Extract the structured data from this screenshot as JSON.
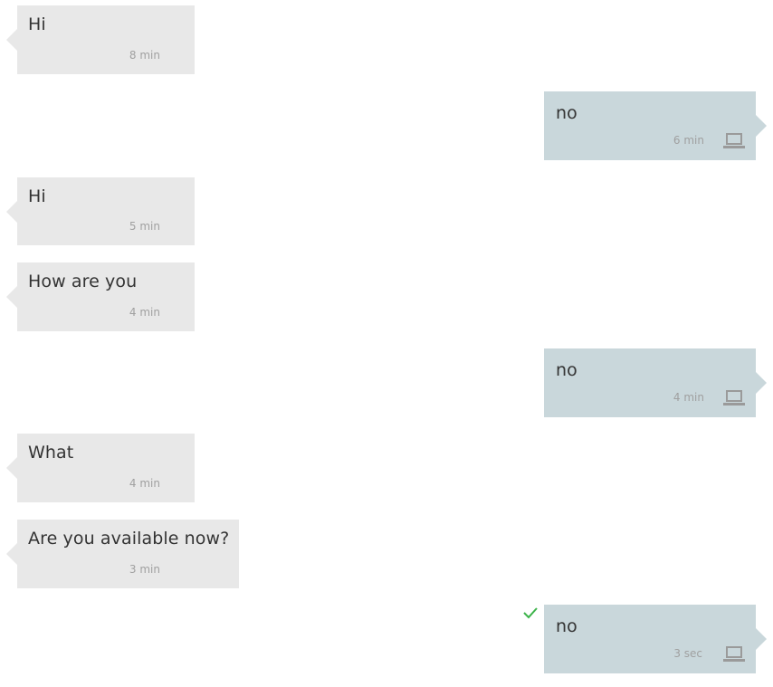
{
  "colors": {
    "incoming_bubble": "#e8e8e8",
    "outgoing_bubble": "#c9d7db",
    "message_text": "#333333",
    "timestamp": "#a0a0a0",
    "device_icon": "#9a9a9a",
    "sent_check": "#3cb34a"
  },
  "messages": [
    {
      "direction": "incoming",
      "text": "Hi",
      "time": "8 min"
    },
    {
      "direction": "outgoing",
      "text": "no",
      "time": "6 min",
      "icon": "laptop-icon"
    },
    {
      "direction": "incoming",
      "text": "Hi",
      "time": "5 min"
    },
    {
      "direction": "incoming",
      "text": "How are you",
      "time": "4 min"
    },
    {
      "direction": "outgoing",
      "text": "no",
      "time": "4 min",
      "icon": "laptop-icon"
    },
    {
      "direction": "incoming",
      "text": "What",
      "time": "4 min"
    },
    {
      "direction": "incoming",
      "text": "Are you available now?",
      "time": "3 min"
    },
    {
      "direction": "outgoing",
      "text": "no",
      "time": "3 sec",
      "icon": "laptop-icon",
      "status_icon": "checkmark-icon"
    }
  ]
}
